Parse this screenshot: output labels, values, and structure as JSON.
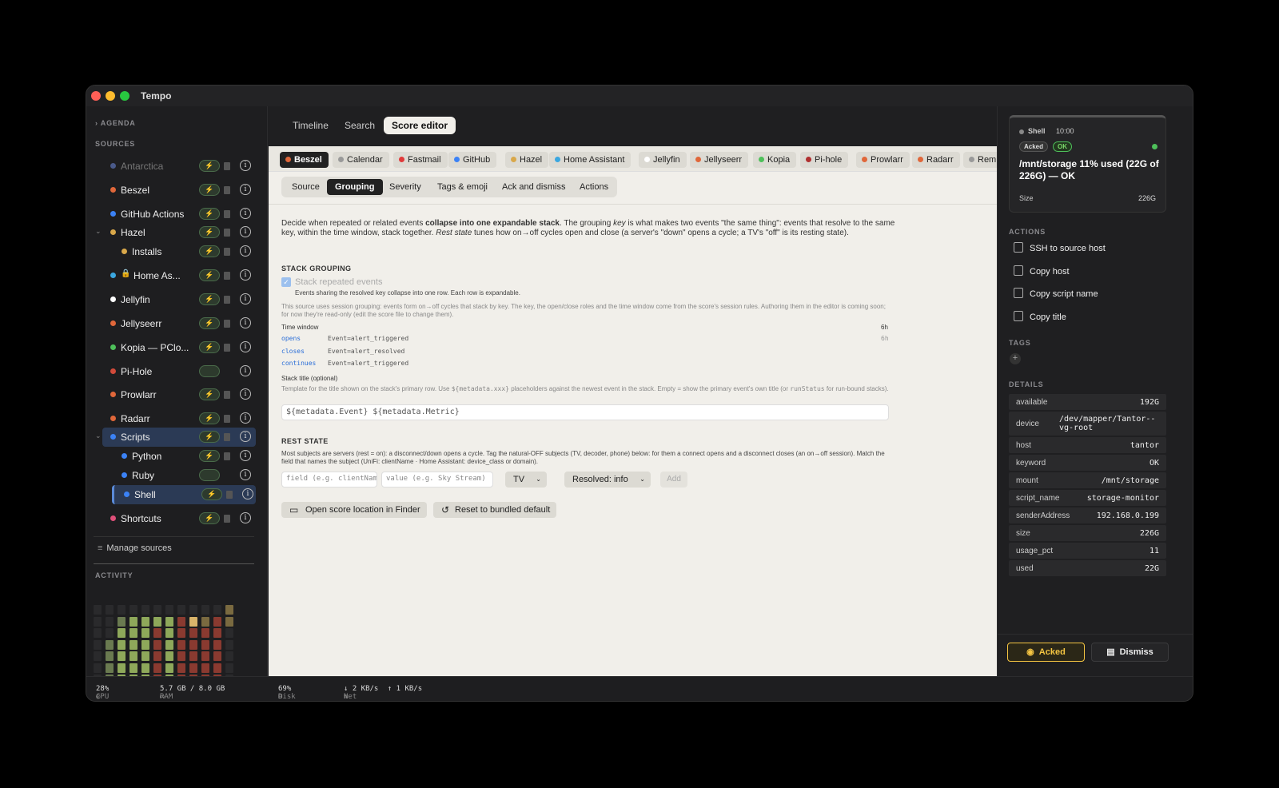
{
  "window": {
    "title": "Tempo"
  },
  "sidebar": {
    "agenda_label": "AGENDA",
    "sources_label": "SOURCES",
    "sources": [
      {
        "name": "Antarctica",
        "color": "#4a5a8a",
        "muted": true
      },
      {
        "name": "Beszel",
        "color": "#e0673a"
      },
      {
        "name": "GitHub Actions",
        "color": "#3b82f6"
      },
      {
        "name": "Hazel",
        "color": "#d9a84a",
        "expanded": true
      },
      {
        "name": "Installs",
        "color": "#d9a84a",
        "child": true
      },
      {
        "name": "Home As...",
        "color": "#3ba7e0",
        "locked": true
      },
      {
        "name": "Jellyfin",
        "color": "#ffffff"
      },
      {
        "name": "Jellyseerr",
        "color": "#e0673a"
      },
      {
        "name": "Kopia — PClo...",
        "color": "#4ec05a"
      },
      {
        "name": "Pi-Hole",
        "color": "#d24a3a"
      },
      {
        "name": "Prowlarr",
        "color": "#e0673a"
      },
      {
        "name": "Radarr",
        "color": "#e0673a"
      },
      {
        "name": "Scripts",
        "color": "#3b82f6",
        "selected": true,
        "expanded": true
      },
      {
        "name": "Python",
        "color": "#3b82f6",
        "child": true
      },
      {
        "name": "Ruby",
        "color": "#3b82f6",
        "child": true
      },
      {
        "name": "Shell",
        "color": "#3b82f6",
        "child": true,
        "selected": true
      },
      {
        "name": "Shortcuts",
        "color": "#e0507a"
      }
    ],
    "manage_label": "Manage sources",
    "activity_label": "ACTIVITY"
  },
  "statusbar": {
    "cpu_label": "CPU",
    "cpu_value": "28%",
    "ram_label": "RAM",
    "ram_value": "5.7 GB / 8.0 GB",
    "disk_label": "Disk",
    "disk_value": "69%",
    "net_label": "Net",
    "net_down": "↓ 2 KB/s",
    "net_up": "↑ 1 KB/s"
  },
  "main": {
    "top_tabs": [
      "Timeline",
      "Search",
      "Score editor"
    ],
    "active_top_tab": "Score editor",
    "source_chips": [
      {
        "label": "Beszel",
        "color": "#e0673a",
        "active": true
      },
      {
        "label": "Calendar",
        "color": "#999999"
      },
      {
        "label": "Fastmail",
        "color": "#e03a3a"
      },
      {
        "label": "GitHub",
        "color": "#3b82f6"
      },
      {
        "label": "Hazel",
        "color": "#d9a84a"
      },
      {
        "label": "Home Assistant",
        "color": "#3ba7e0"
      },
      {
        "label": "Jellyfin",
        "color": "#ffffff"
      },
      {
        "label": "Jellyseerr",
        "color": "#e0673a"
      },
      {
        "label": "Kopia",
        "color": "#4ec05a"
      },
      {
        "label": "Pi-hole",
        "color": "#b03030"
      },
      {
        "label": "Prowlarr",
        "color": "#e0673a"
      },
      {
        "label": "Radarr",
        "color": "#e0673a"
      },
      {
        "label": "Remi",
        "color": "#999999"
      }
    ],
    "sub_tabs": [
      "Source",
      "Grouping",
      "Severity",
      "Tags & emoji",
      "Ack and dismiss",
      "Actions"
    ],
    "active_sub_tab": "Grouping",
    "intro_a": "Decide when repeated or related events ",
    "intro_b": "collapse into one expandable stack",
    "intro_c": ". The grouping ",
    "intro_d": "key",
    "intro_e": " is what makes two events \"the same thing\": events that resolve to the same key, within the time window, stack together. ",
    "intro_f": "Rest state",
    "intro_g": " tunes how on→off cycles open and close (a server's \"down\" opens a cycle; a TV's \"off\" is its resting state).",
    "stack_grouping_heading": "STACK GROUPING",
    "stack_checkbox_label": "Stack repeated events",
    "stack_checkbox_help": "Events sharing the resolved key collapse into one row. Each row is expandable.",
    "session_note": "This source uses session grouping: events form on→off cycles that stack by key. The key, the open/close roles and the time window come from the score's session rules. Authoring them in the editor is coming soon; for now they're read-only (edit the score file to change them).",
    "time_window_label": "Time window",
    "time_window_value": "6h",
    "roles": [
      {
        "role": "opens",
        "match": "Event=alert_triggered",
        "extra": "6h"
      },
      {
        "role": "closes",
        "match": "Event=alert_resolved",
        "extra": ""
      },
      {
        "role": "continues",
        "match": "Event=alert_triggered",
        "extra": ""
      }
    ],
    "stack_title_label": "Stack title (optional)",
    "stack_title_help_a": "Template for the title shown on the stack's primary row. Use ",
    "stack_title_help_b": "${metadata.xxx}",
    "stack_title_help_c": " placeholders against the newest event in the stack. Empty = show the primary event's own title (or ",
    "stack_title_help_d": "runStatus",
    "stack_title_help_e": " for run-bound stacks).",
    "stack_title_value": "${metadata.Event} ${metadata.Metric}",
    "rest_state_heading": "REST STATE",
    "rest_state_help": "Most subjects are servers (rest = on): a disconnect/down opens a cycle. Tag the natural-OFF subjects (TV, decoder, phone) below: for them a connect opens and a disconnect closes (an on→off session). Match the field that names the subject (UniFi: clientName · Home Assistant: device_class or domain).",
    "field_placeholder": "field (e.g. clientNam",
    "value_placeholder": "value (e.g. Sky Stream)",
    "kind_select": "TV",
    "resolved_select": "Resolved: info",
    "add_label": "Add",
    "open_finder_label": "Open score location in Finder",
    "reset_label": "Reset to bundled default"
  },
  "detail": {
    "card": {
      "source": "Shell",
      "time": "10:00",
      "badge_acked": "Acked",
      "badge_ok": "OK",
      "title": "/mnt/storage 11% used (22G of 226G) — OK",
      "size_label": "Size",
      "size_value": "226G"
    },
    "actions_heading": "ACTIONS",
    "actions": [
      "SSH to source host",
      "Copy host",
      "Copy script name",
      "Copy title"
    ],
    "tags_heading": "TAGS",
    "add_tag": "+",
    "details_heading": "DETAILS",
    "details": [
      {
        "k": "available",
        "v": "192G"
      },
      {
        "k": "device",
        "v": "/dev/mapper/Tantor--vg-root"
      },
      {
        "k": "host",
        "v": "tantor"
      },
      {
        "k": "keyword",
        "v": "OK"
      },
      {
        "k": "mount",
        "v": "/mnt/storage"
      },
      {
        "k": "script_name",
        "v": "storage-monitor"
      },
      {
        "k": "senderAddress",
        "v": "192.168.0.199"
      },
      {
        "k": "size",
        "v": "226G"
      },
      {
        "k": "usage_pct",
        "v": "11"
      },
      {
        "k": "used",
        "v": "22G"
      }
    ],
    "acked_button": "Acked",
    "dismiss_button": "Dismiss"
  },
  "colors": {
    "accent": "#3b82f6",
    "acked": "#f5c542",
    "ok": "#4ec05a"
  }
}
